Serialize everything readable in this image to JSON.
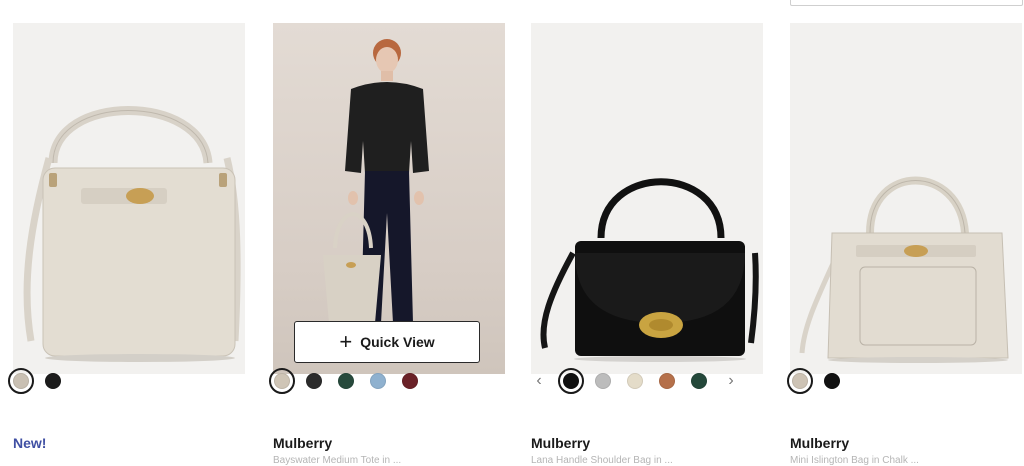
{
  "products": [
    {
      "title": "New!",
      "description": "",
      "swatches": [
        {
          "color": "#c9c0b3",
          "selected": true
        },
        {
          "color": "#1c1c1c",
          "selected": false
        }
      ]
    },
    {
      "title": "Mulberry",
      "description": "Bayswater Medium Tote in ...",
      "quick_view_label": "Quick View",
      "swatches": [
        {
          "color": "#cfc5b6",
          "selected": true
        },
        {
          "color": "#2b2b2b",
          "selected": false
        },
        {
          "color": "#274a3c",
          "selected": false
        },
        {
          "color": "#8fb1cf",
          "selected": false
        },
        {
          "color": "#6b2228",
          "selected": false
        }
      ]
    },
    {
      "title": "Mulberry",
      "description": "Lana Handle Shoulder Bag in ...",
      "swatches": [
        {
          "color": "#111111",
          "selected": true
        },
        {
          "color": "#bcbcbc",
          "selected": false
        },
        {
          "color": "#e4dcc9",
          "selected": false
        },
        {
          "color": "#b5704a",
          "selected": false
        },
        {
          "color": "#24483a",
          "selected": false
        }
      ]
    },
    {
      "title": "Mulberry",
      "description": "Mini Islington Bag in Chalk ...",
      "swatches": [
        {
          "color": "#cdc3b5",
          "selected": true
        },
        {
          "color": "#111111",
          "selected": false
        }
      ]
    }
  ],
  "icons": {
    "prev": "‹",
    "next": "›"
  }
}
